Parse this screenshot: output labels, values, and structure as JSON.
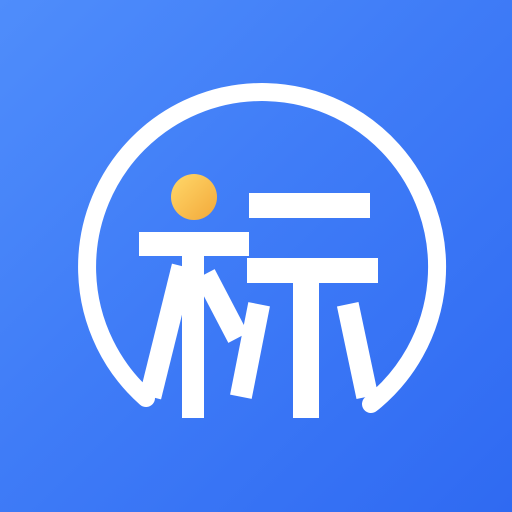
{
  "app_icon": {
    "glyph": "标",
    "icon_name": "biao-character-logo-icon",
    "colors": {
      "background_start": "#4f8dfb",
      "background_end": "#2f6af2",
      "foreground": "#ffffff",
      "accent_dot_start": "#ffd86a",
      "accent_dot_end": "#f3a93a"
    }
  }
}
